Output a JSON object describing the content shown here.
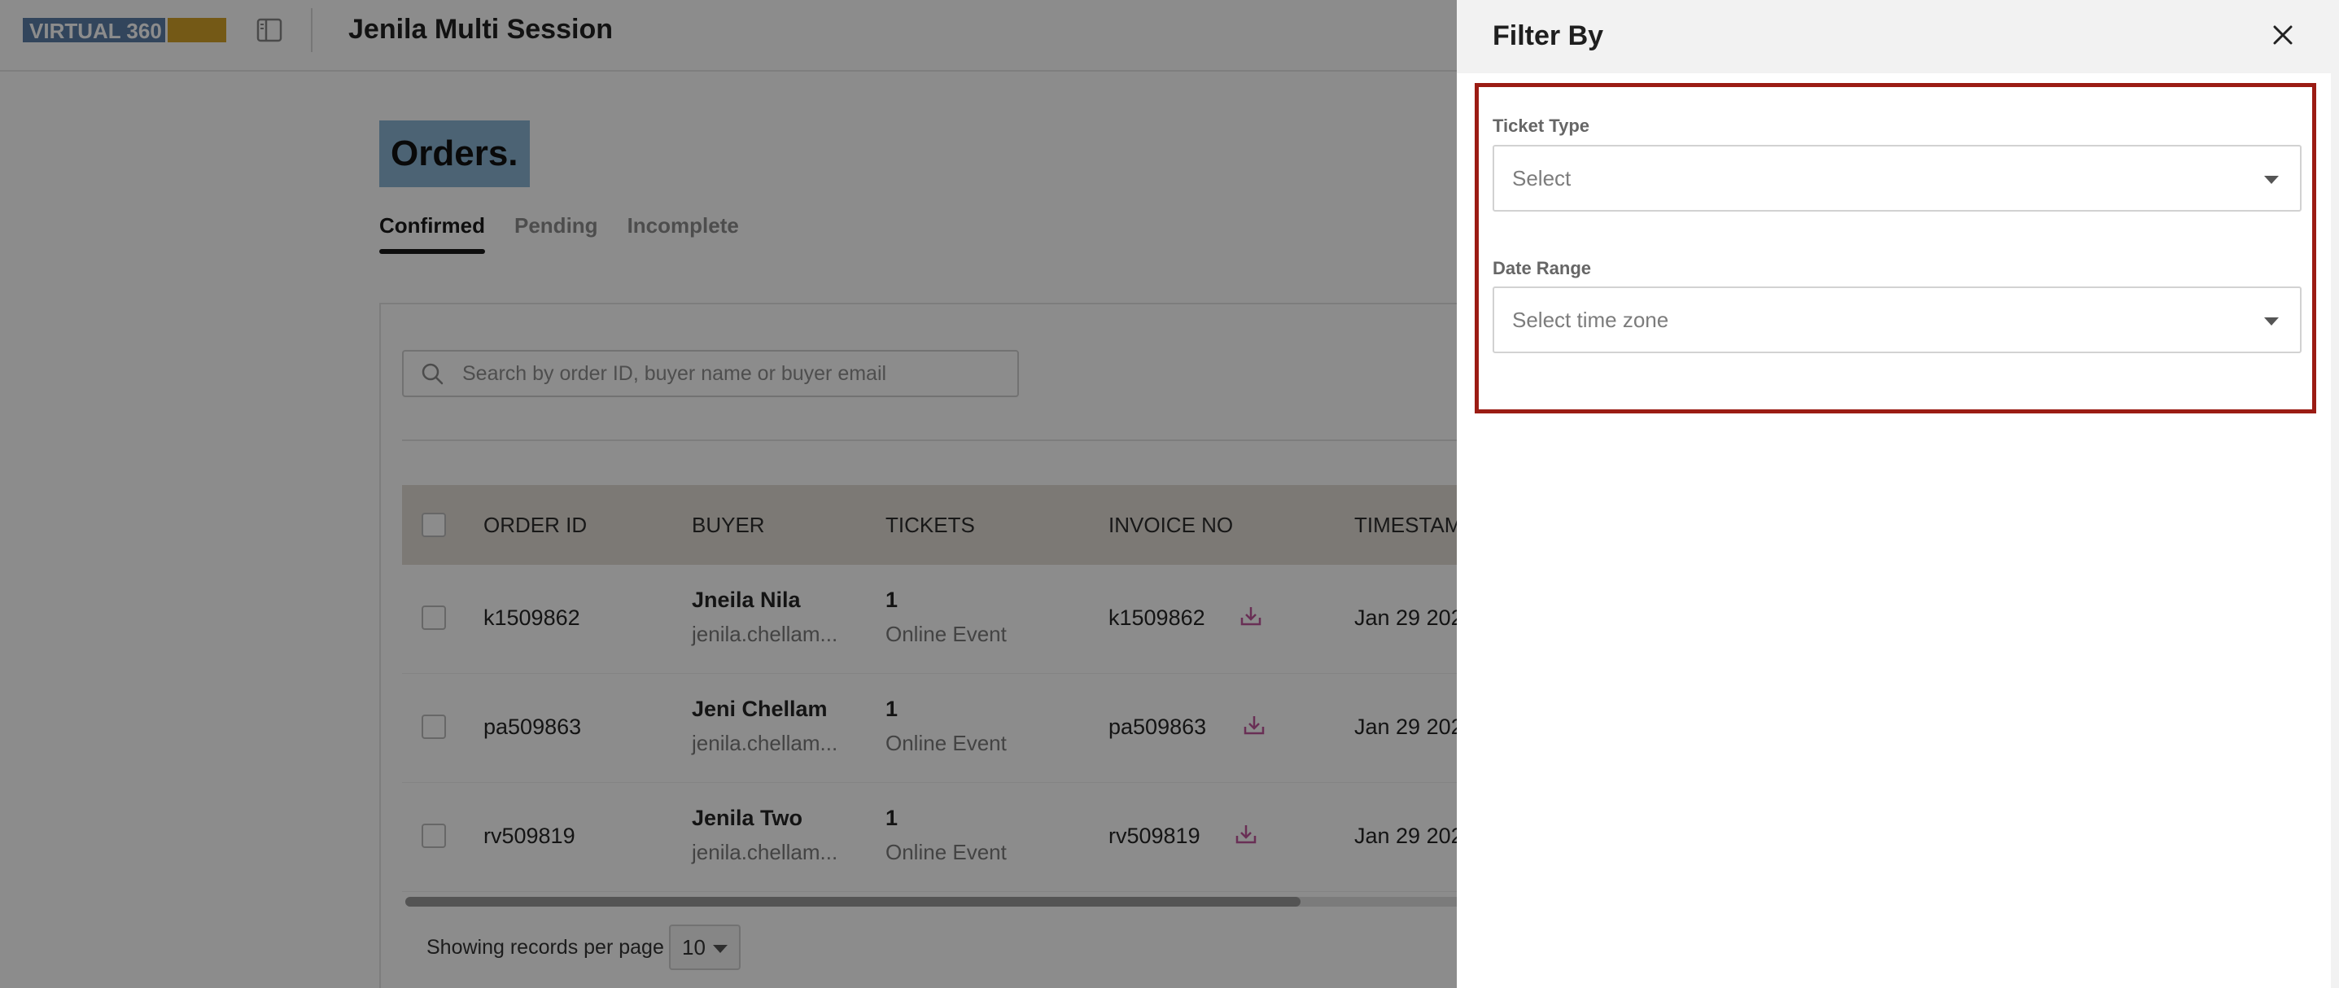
{
  "header": {
    "logo_text": "VIRTUAL 360",
    "event_title": "Jenila Multi Session"
  },
  "page": {
    "title": "Orders.",
    "tabs": [
      {
        "label": "Confirmed",
        "active": true
      },
      {
        "label": "Pending",
        "active": false
      },
      {
        "label": "Incomplete",
        "active": false
      }
    ],
    "search_placeholder": "Search by order ID, buyer name or buyer email"
  },
  "table": {
    "columns": [
      "ORDER ID",
      "BUYER",
      "TICKETS",
      "INVOICE NO",
      "TIMESTAM"
    ],
    "rows": [
      {
        "order_id": "k1509862",
        "buyer_name": "Jneila Nila",
        "buyer_email": "jenila.chellam...",
        "ticket_count": "1",
        "ticket_type": "Online Event",
        "invoice_no": "k1509862",
        "timestamp": "Jan 29 202"
      },
      {
        "order_id": "pa509863",
        "buyer_name": "Jeni Chellam",
        "buyer_email": "jenila.chellam...",
        "ticket_count": "1",
        "ticket_type": "Online Event",
        "invoice_no": "pa509863",
        "timestamp": "Jan 29 202"
      },
      {
        "order_id": "rv509819",
        "buyer_name": "Jenila Two",
        "buyer_email": "jenila.chellam...",
        "ticket_count": "1",
        "ticket_type": "Online Event",
        "invoice_no": "rv509819",
        "timestamp": "Jan 29 202"
      }
    ]
  },
  "pagination": {
    "label": "Showing records per page",
    "per_page": "10"
  },
  "drawer": {
    "title": "Filter By",
    "ticket_type": {
      "label": "Ticket Type",
      "placeholder": "Select"
    },
    "date_range": {
      "label": "Date Range",
      "placeholder": "Select time zone"
    }
  },
  "colors": {
    "highlight_border": "#9b1c14",
    "download_icon": "#c0569b",
    "title_highlight": "#8ab4d4",
    "table_header": "#e2ddd6"
  }
}
